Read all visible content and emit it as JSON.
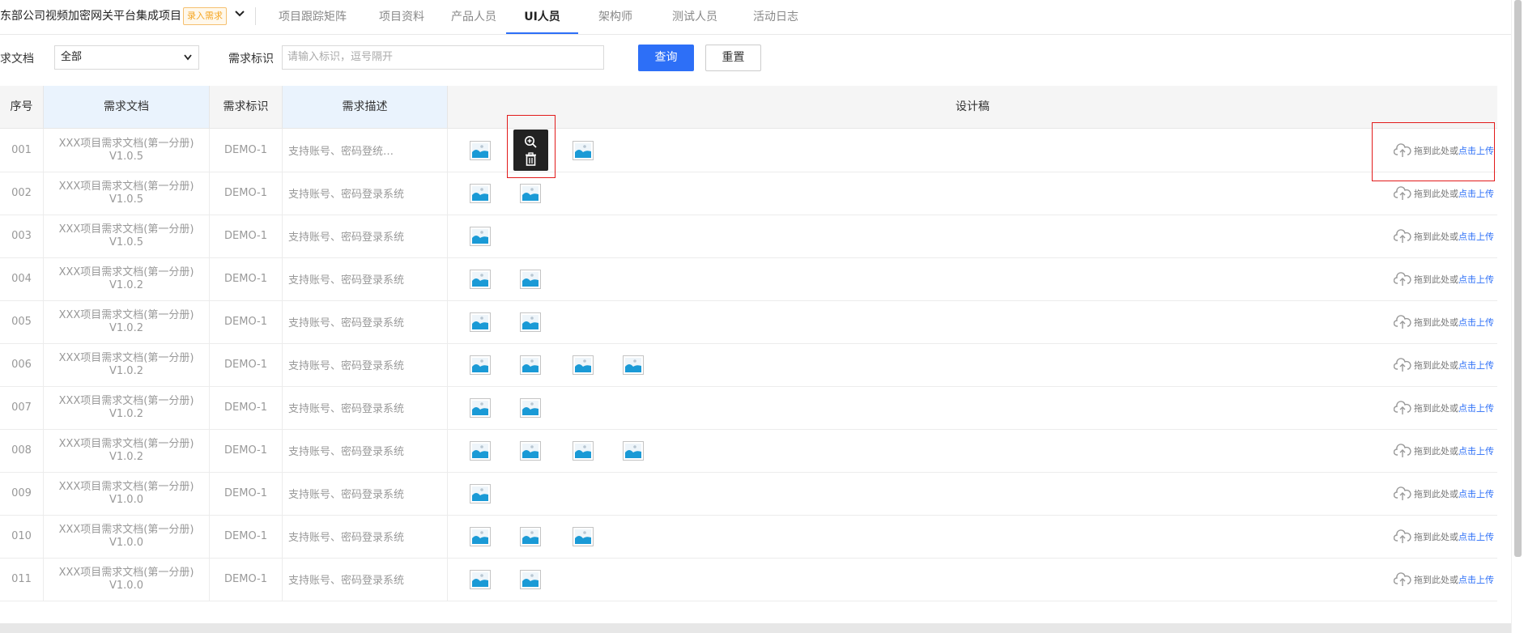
{
  "header": {
    "project_title": "东部公司视频加密网关平台集成项目",
    "badge": "录入需求",
    "tabs": [
      {
        "label": "项目跟踪矩阵",
        "active": false
      },
      {
        "label": "项目资料",
        "active": false
      },
      {
        "label": "产品人员",
        "active": false
      },
      {
        "label": "UI人员",
        "active": true
      },
      {
        "label": "架构师",
        "active": false
      },
      {
        "label": "测试人员",
        "active": false
      },
      {
        "label": "活动日志",
        "active": false
      }
    ]
  },
  "filters": {
    "doc_label": "需求文档",
    "doc_value": "全部",
    "tag_label": "需求标识",
    "tag_placeholder": "请输入标识，逗号隔开",
    "query_button": "查询",
    "reset_button": "重置"
  },
  "table": {
    "columns": [
      "序号",
      "需求文档",
      "需求标识",
      "需求描述",
      "设计稿"
    ],
    "upload": {
      "drag_text": "拖到此处或",
      "click_text": "点击上传"
    },
    "rows": [
      {
        "no": "001",
        "doc_line1": "XXX项目需求文档(第一分册)",
        "doc_line2": "V1.0.5",
        "tag": "DEMO-1",
        "desc": "支持账号、密码登统…",
        "images": 3
      },
      {
        "no": "002",
        "doc_line1": "XXX项目需求文档(第一分册)",
        "doc_line2": "V1.0.5",
        "tag": "DEMO-1",
        "desc": "支持账号、密码登录系统",
        "images": 2
      },
      {
        "no": "003",
        "doc_line1": "XXX项目需求文档(第一分册)",
        "doc_line2": "V1.0.5",
        "tag": "DEMO-1",
        "desc": "支持账号、密码登录系统",
        "images": 1
      },
      {
        "no": "004",
        "doc_line1": "XXX项目需求文档(第一分册)",
        "doc_line2": "V1.0.2",
        "tag": "DEMO-1",
        "desc": "支持账号、密码登录系统",
        "images": 2
      },
      {
        "no": "005",
        "doc_line1": "XXX项目需求文档(第一分册)",
        "doc_line2": "V1.0.2",
        "tag": "DEMO-1",
        "desc": "支持账号、密码登录系统",
        "images": 2
      },
      {
        "no": "006",
        "doc_line1": "XXX项目需求文档(第一分册)",
        "doc_line2": "V1.0.2",
        "tag": "DEMO-1",
        "desc": "支持账号、密码登录系统",
        "images": 4
      },
      {
        "no": "007",
        "doc_line1": "XXX项目需求文档(第一分册)",
        "doc_line2": "V1.0.2",
        "tag": "DEMO-1",
        "desc": "支持账号、密码登录系统",
        "images": 2
      },
      {
        "no": "008",
        "doc_line1": "XXX项目需求文档(第一分册)",
        "doc_line2": "V1.0.2",
        "tag": "DEMO-1",
        "desc": "支持账号、密码登录系统",
        "images": 4
      },
      {
        "no": "009",
        "doc_line1": "XXX项目需求文档(第一分册)",
        "doc_line2": "V1.0.0",
        "tag": "DEMO-1",
        "desc": "支持账号、密码登录系统",
        "images": 1
      },
      {
        "no": "010",
        "doc_line1": "XXX项目需求文档(第一分册)",
        "doc_line2": "V1.0.0",
        "tag": "DEMO-1",
        "desc": "支持账号、密码登录系统",
        "images": 3
      },
      {
        "no": "011",
        "doc_line1": "XXX项目需求文档(第一分册)",
        "doc_line2": "V1.0.0",
        "tag": "DEMO-1",
        "desc": "支持账号、密码登录系统",
        "images": 2
      }
    ]
  },
  "popover": {
    "icons": [
      "zoom-in-icon",
      "trash-icon"
    ]
  },
  "colors": {
    "accent": "#2d6ff7",
    "badge": "#f5a623",
    "highlight_box": "#e21b1b",
    "image_icon": "#1a9ad6"
  }
}
